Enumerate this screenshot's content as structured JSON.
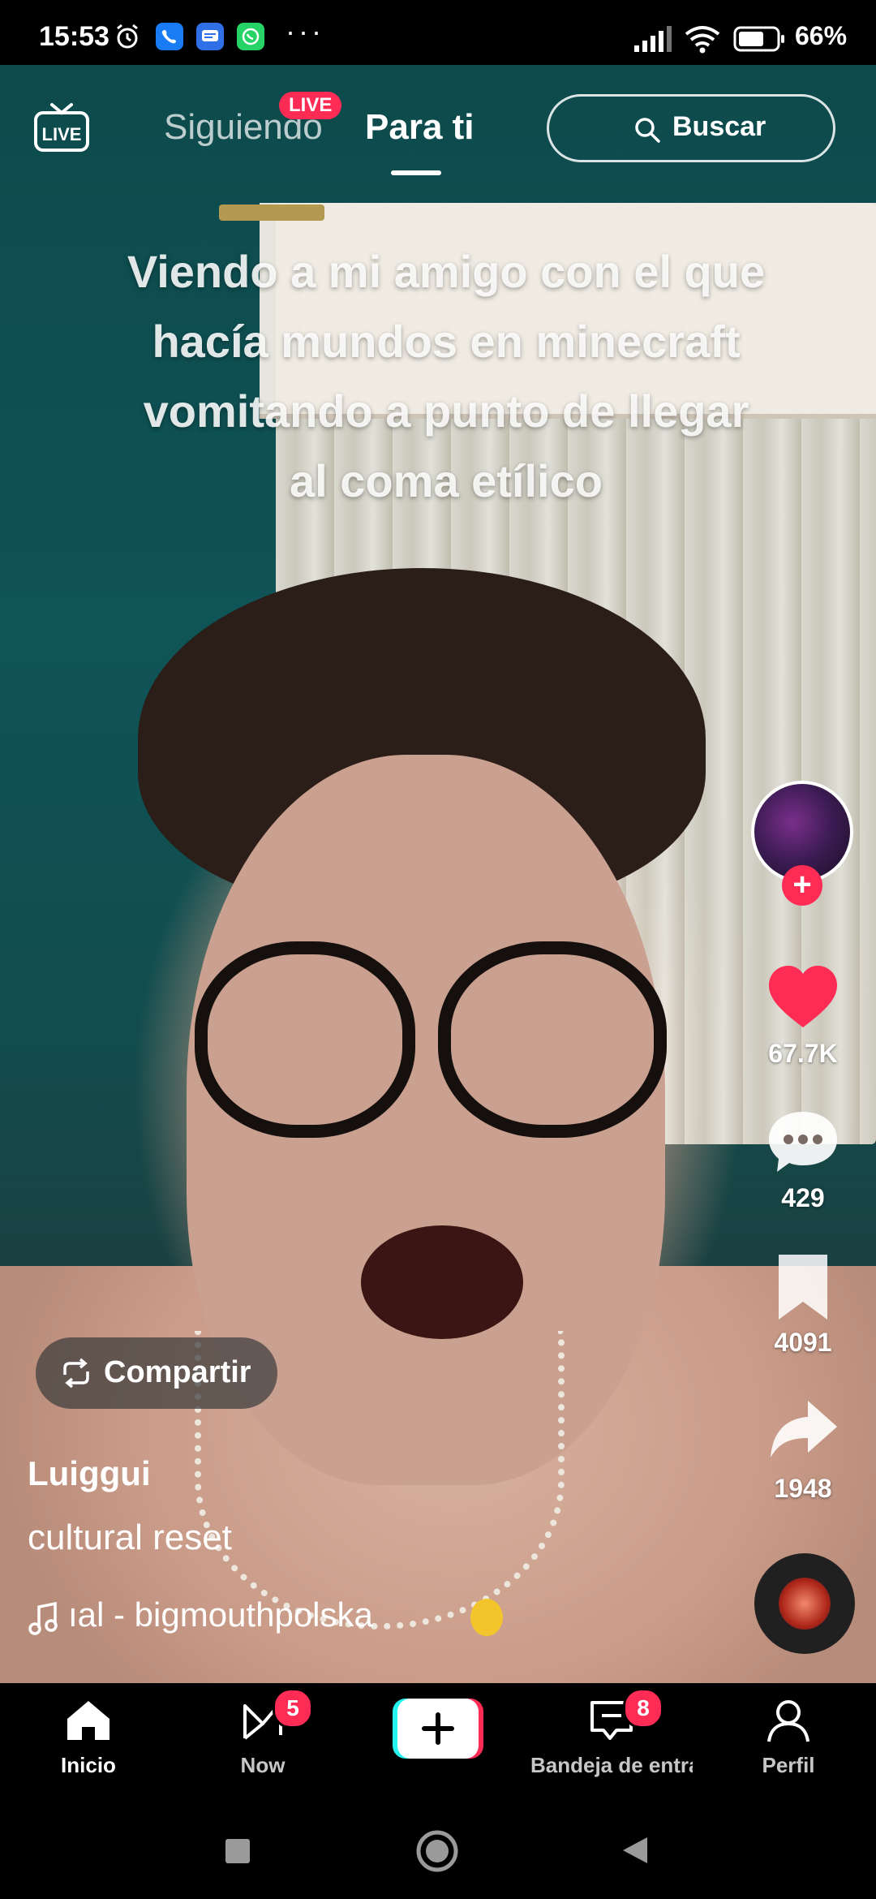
{
  "status_bar": {
    "time": "15:53",
    "battery_percent": "66%",
    "more_indicator": "···",
    "icons": [
      "alarm-icon",
      "phone-app-icon",
      "messages-app-icon",
      "whatsapp-icon",
      "signal-icon",
      "wifi-icon",
      "battery-icon"
    ]
  },
  "header": {
    "live_icon_label": "LIVE",
    "tab_following": "Siguiendo",
    "live_badge": "LIVE",
    "tab_for_you": "Para ti",
    "search_label": "Buscar"
  },
  "video": {
    "caption": "Viendo a mi amigo con el que hacía mundos en minecraft vomitando a punto de llegar al coma etílico",
    "share_label": "Compartir",
    "author": "Luiggui",
    "description": "cultural reset",
    "music": "ıal - bigmouthpolska"
  },
  "actions": {
    "likes": "67.7K",
    "comments": "429",
    "saves": "4091",
    "shares": "1948"
  },
  "bottom_nav": {
    "home": "Inicio",
    "now": "Now",
    "now_badge": "5",
    "inbox": "Bandeja de entrada",
    "inbox_badge": "8",
    "profile": "Perfil"
  },
  "colors": {
    "accent": "#fe2c55",
    "cyan": "#25f4ee",
    "background": "#000000"
  }
}
